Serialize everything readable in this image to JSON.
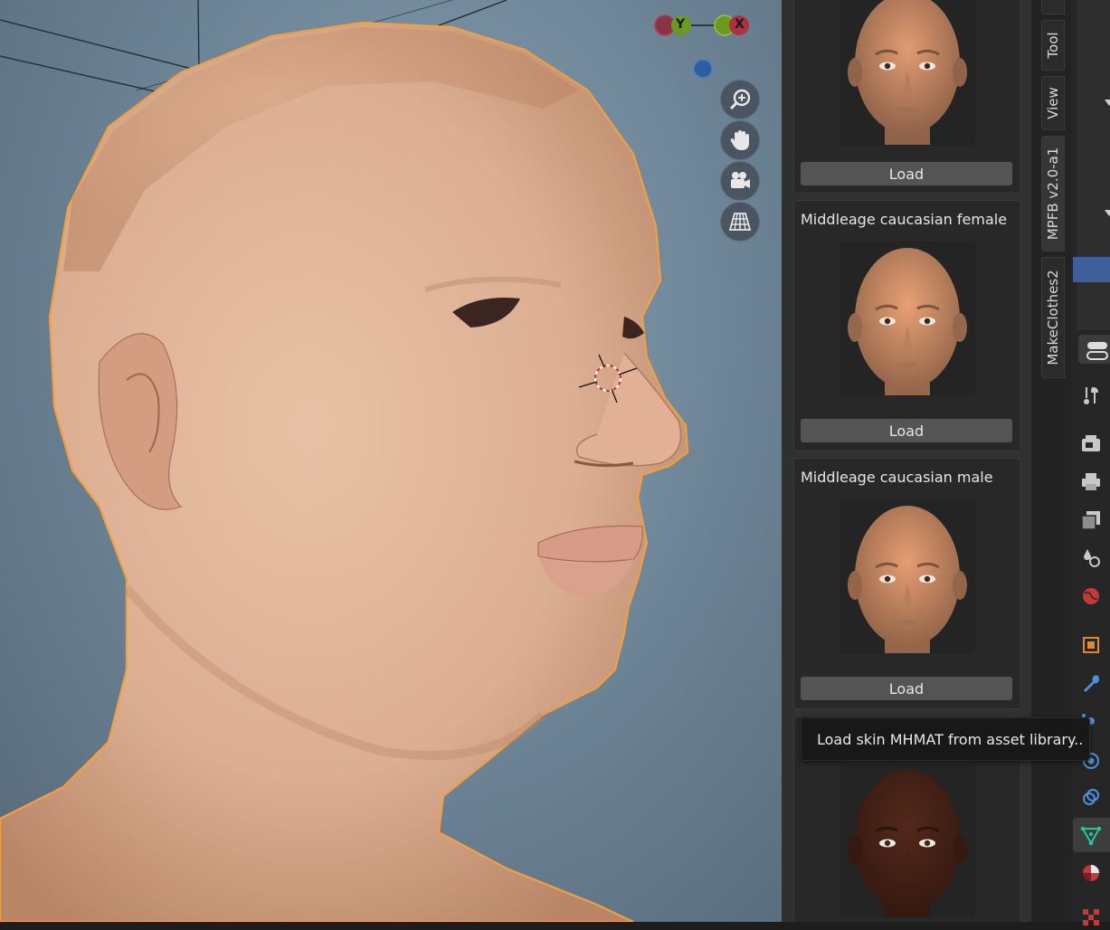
{
  "viewport": {
    "gizmo": {
      "y_label": "Y",
      "x_label": "X"
    },
    "nav_buttons": [
      "zoom-icon",
      "hand-pan-icon",
      "camera-icon",
      "grid-perspective-icon"
    ]
  },
  "asset_panel": {
    "cards": [
      {
        "title": "",
        "load_label": "Load",
        "skin_tone": "#c98a66"
      },
      {
        "title": "Middleage caucasian female",
        "load_label": "Load",
        "skin_tone": "#cf8f68"
      },
      {
        "title": "Middleage caucasian male",
        "load_label": "Load",
        "skin_tone": "#cd8c66"
      },
      {
        "title": "",
        "load_label": "",
        "skin_tone": "#4b2418"
      }
    ]
  },
  "sidebar_tabs": [
    "Tool",
    "View",
    "MPFB v2.0-a1",
    "MakeClothes2"
  ],
  "properties_icons": [
    "tool-icon",
    "render-icon",
    "output-icon",
    "view-layer-icon",
    "scene-icon",
    "world-icon",
    "object-icon",
    "modifier-icon",
    "particles-icon",
    "physics-icon",
    "mesh-data-icon",
    "material-icon",
    "texture-icon"
  ],
  "tooltip": {
    "text": "Load skin MHMAT from asset library.."
  },
  "colors": {
    "selection_outline": "#f0a040",
    "mesh_data_icon": "#27c4a0"
  }
}
